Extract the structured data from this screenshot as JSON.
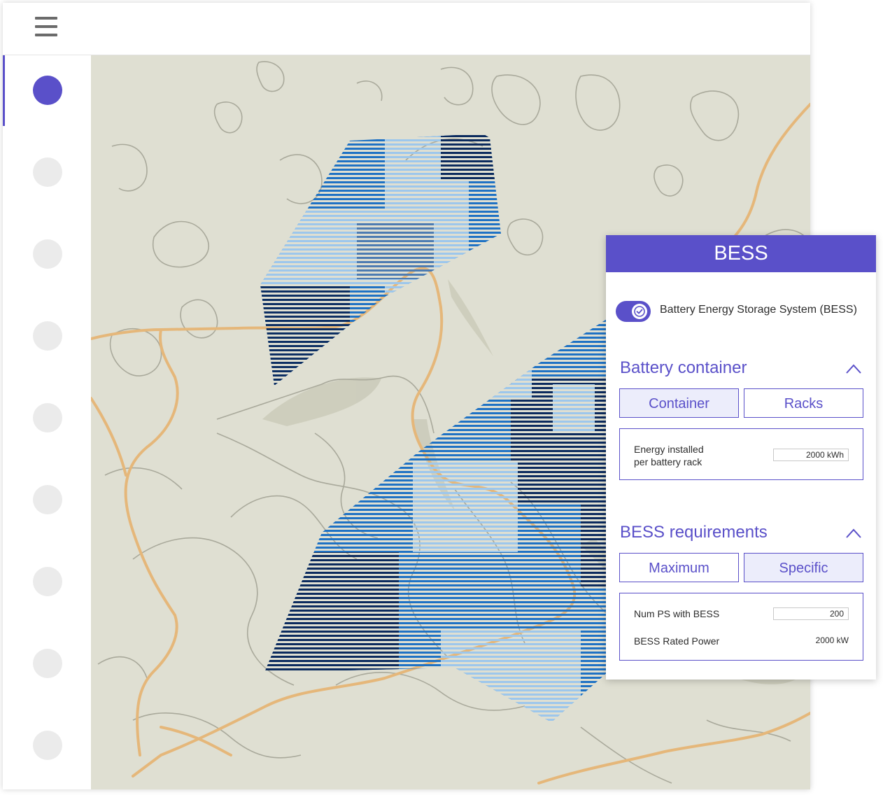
{
  "panel": {
    "title": "BESS",
    "toggle": {
      "label": "Battery Energy Storage System (BESS)",
      "checked": true
    },
    "battery_container": {
      "title": "Battery container",
      "options": [
        "Container",
        "Racks"
      ],
      "selected": "Container",
      "field": {
        "label_line1": "Energy installed",
        "label_line2": "per battery rack",
        "value": "2000 kWh"
      }
    },
    "bess_requirements": {
      "title": "BESS requirements",
      "options": [
        "Maximum",
        "Specific"
      ],
      "selected": "Specific",
      "num_ps": {
        "label": "Num PS with BESS",
        "value": "200"
      },
      "rated_power": {
        "label": "BESS Rated Power",
        "value": "2000 kW"
      }
    }
  },
  "colors": {
    "accent": "#5a50c9",
    "map_background": "#dfdfd2",
    "road": "#e5b77a",
    "contour": "#a9a99b",
    "panel_dark": "#0c2b5e",
    "panel_mid": "#1f72c4",
    "panel_light": "#9dc7ec"
  },
  "icons": {
    "menu": "hamburger-menu-icon",
    "toggle_check": "check-icon",
    "collapse": "chevron-up-icon"
  }
}
